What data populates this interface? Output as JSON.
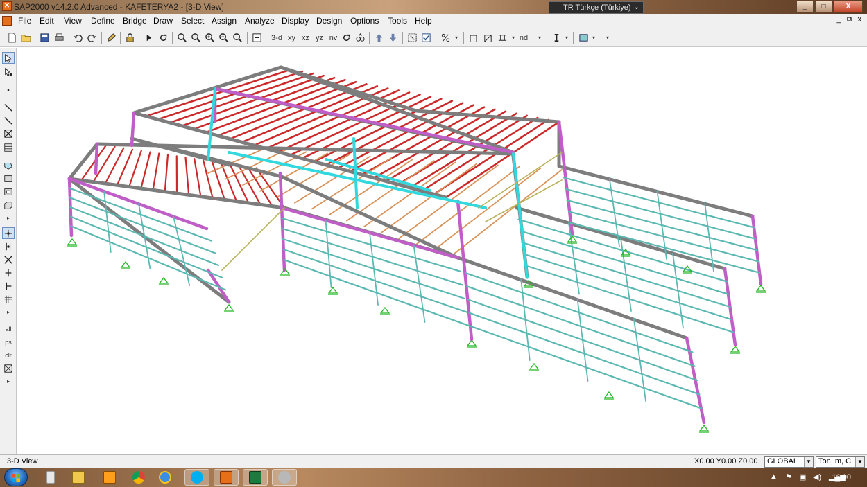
{
  "window": {
    "title": "SAP2000 v14.2.0 Advanced  - KAFETERYA2 - [3-D View]",
    "language": "TR Türkçe (Türkiye)",
    "controls": [
      "_",
      "□",
      "X"
    ],
    "mdi_controls": [
      "_",
      "⧉",
      "x"
    ]
  },
  "menu": [
    "File",
    "Edit",
    "View",
    "Define",
    "Bridge",
    "Draw",
    "Select",
    "Assign",
    "Analyze",
    "Display",
    "Design",
    "Options",
    "Tools",
    "Help"
  ],
  "toolbar": {
    "view_buttons": [
      "3-d",
      "xy",
      "xz",
      "yz",
      "nv"
    ],
    "nd_label": "nd",
    "icons": [
      "new-icon",
      "open-icon",
      "save-icon",
      "print-icon",
      "undo-icon",
      "redo-icon",
      "pencil-icon",
      "lock-icon",
      "run-icon",
      "refresh-icon",
      "zoom-window-icon",
      "zoom-full-icon",
      "zoom-in-icon",
      "zoom-out-icon",
      "zoom-previous-icon",
      "pan-icon",
      "rotate-icon",
      "perspective-icon",
      "up-icon",
      "down-icon",
      "select-all-icon",
      "checkbox-icon",
      "percent-icon",
      "frame-icon",
      "brace-icon",
      "section-icon",
      "dimension-icon",
      "display-icon"
    ]
  },
  "left_toolbar": {
    "labels": [
      "all",
      "ps",
      "clr"
    ],
    "icons": [
      "pointer-icon",
      "reshape-icon",
      "point-icon",
      "line-icon",
      "line-quick-icon",
      "bracket-icon",
      "poly-icon",
      "area-icon",
      "rect-area-icon",
      "quad-icon",
      "solid-icon",
      "snap-point-icon",
      "snap-end-icon",
      "snap-intersect-icon",
      "snap-perpendicular-icon",
      "snap-line-icon",
      "grid-snap-icon",
      "select-all-icon",
      "previous-select-icon",
      "clear-select-icon",
      "intersect-icon"
    ]
  },
  "statusbar": {
    "view_name": "3-D View",
    "coordinates": "X0.00  Y0.00  Z0.00",
    "coord_system": "GLOBAL",
    "units": "Ton, m, C"
  },
  "taskbar": {
    "apps": [
      "file-icon",
      "folder-icon",
      "media-player-icon",
      "chrome-icon",
      "ie-icon",
      "skype-icon",
      "sap2000-icon",
      "excel-icon",
      "game-icon"
    ],
    "time": "16:00"
  },
  "colors": {
    "purlin_red": "#cc2a2a",
    "member_gray": "#7d7d7d",
    "column_magenta": "#c05ec8",
    "girt_teal": "#5cb8b2",
    "brace_cyan": "#31d8dd",
    "support_green": "#22b822",
    "beam_orange": "#d9935a",
    "brace_olive": "#b8b25a"
  }
}
